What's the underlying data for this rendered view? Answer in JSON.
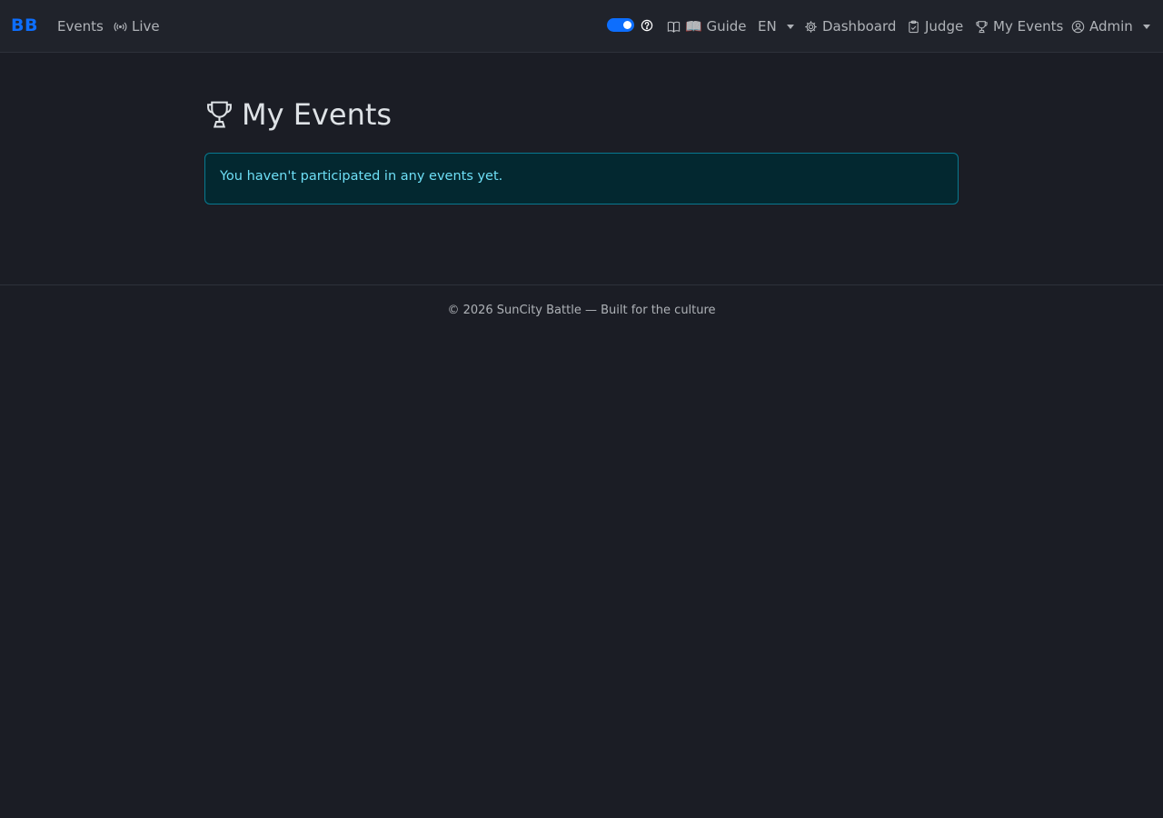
{
  "navbar": {
    "brand": "BB",
    "events_label": "Events",
    "live_label": "Live",
    "guide_label": "📖 Guide",
    "language_label": "EN",
    "dashboard_label": "Dashboard",
    "judge_label": "Judge",
    "my_events_label": "My Events",
    "user_label": "Admin",
    "theme_toggle_on": true
  },
  "main": {
    "title": "My Events",
    "alert_text": "You haven't participated in any events yet."
  },
  "footer": {
    "text": "© 2026 SunCity Battle — Built for the culture"
  },
  "colors": {
    "brand": "#0d6efd",
    "background": "#1b1d25",
    "alert_background": "#032830",
    "alert_border": "#087990",
    "alert_text": "#6edff6"
  },
  "icons": {
    "live": "broadcast-icon",
    "guide": "book-icon",
    "help": "question-circle-icon",
    "dashboard": "gear-icon",
    "judge": "clipboard-check-icon",
    "my_events": "trophy-icon",
    "user": "person-circle-icon",
    "title": "trophy-icon"
  }
}
